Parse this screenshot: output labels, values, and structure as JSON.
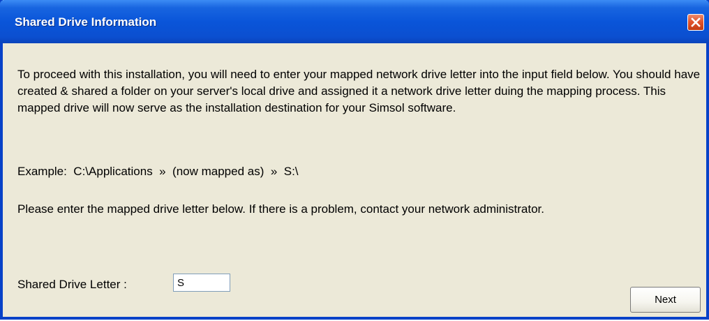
{
  "window": {
    "title": "Shared Drive Information",
    "close_icon": "close-x-icon"
  },
  "body": {
    "instructions": "To proceed with this installation, you will need to enter your mapped network drive letter into the input field below.  You should have created & shared a folder on your server's local drive and assigned it a network drive letter duing the mapping process.  This mapped drive will now serve as the installation destination for your Simsol software.",
    "example": "Example:  C:\\Applications  »  (now mapped as)  »  S:\\",
    "prompt": "Please enter the mapped drive letter below.  If there is a problem, contact your network administrator."
  },
  "form": {
    "drive_label": "Shared Drive Letter :",
    "drive_value": "S"
  },
  "buttons": {
    "next_label": "Next"
  },
  "colors": {
    "titlebar": "#0a55d9",
    "window_bg": "#ece9d8",
    "close_button": "#e2542c"
  }
}
